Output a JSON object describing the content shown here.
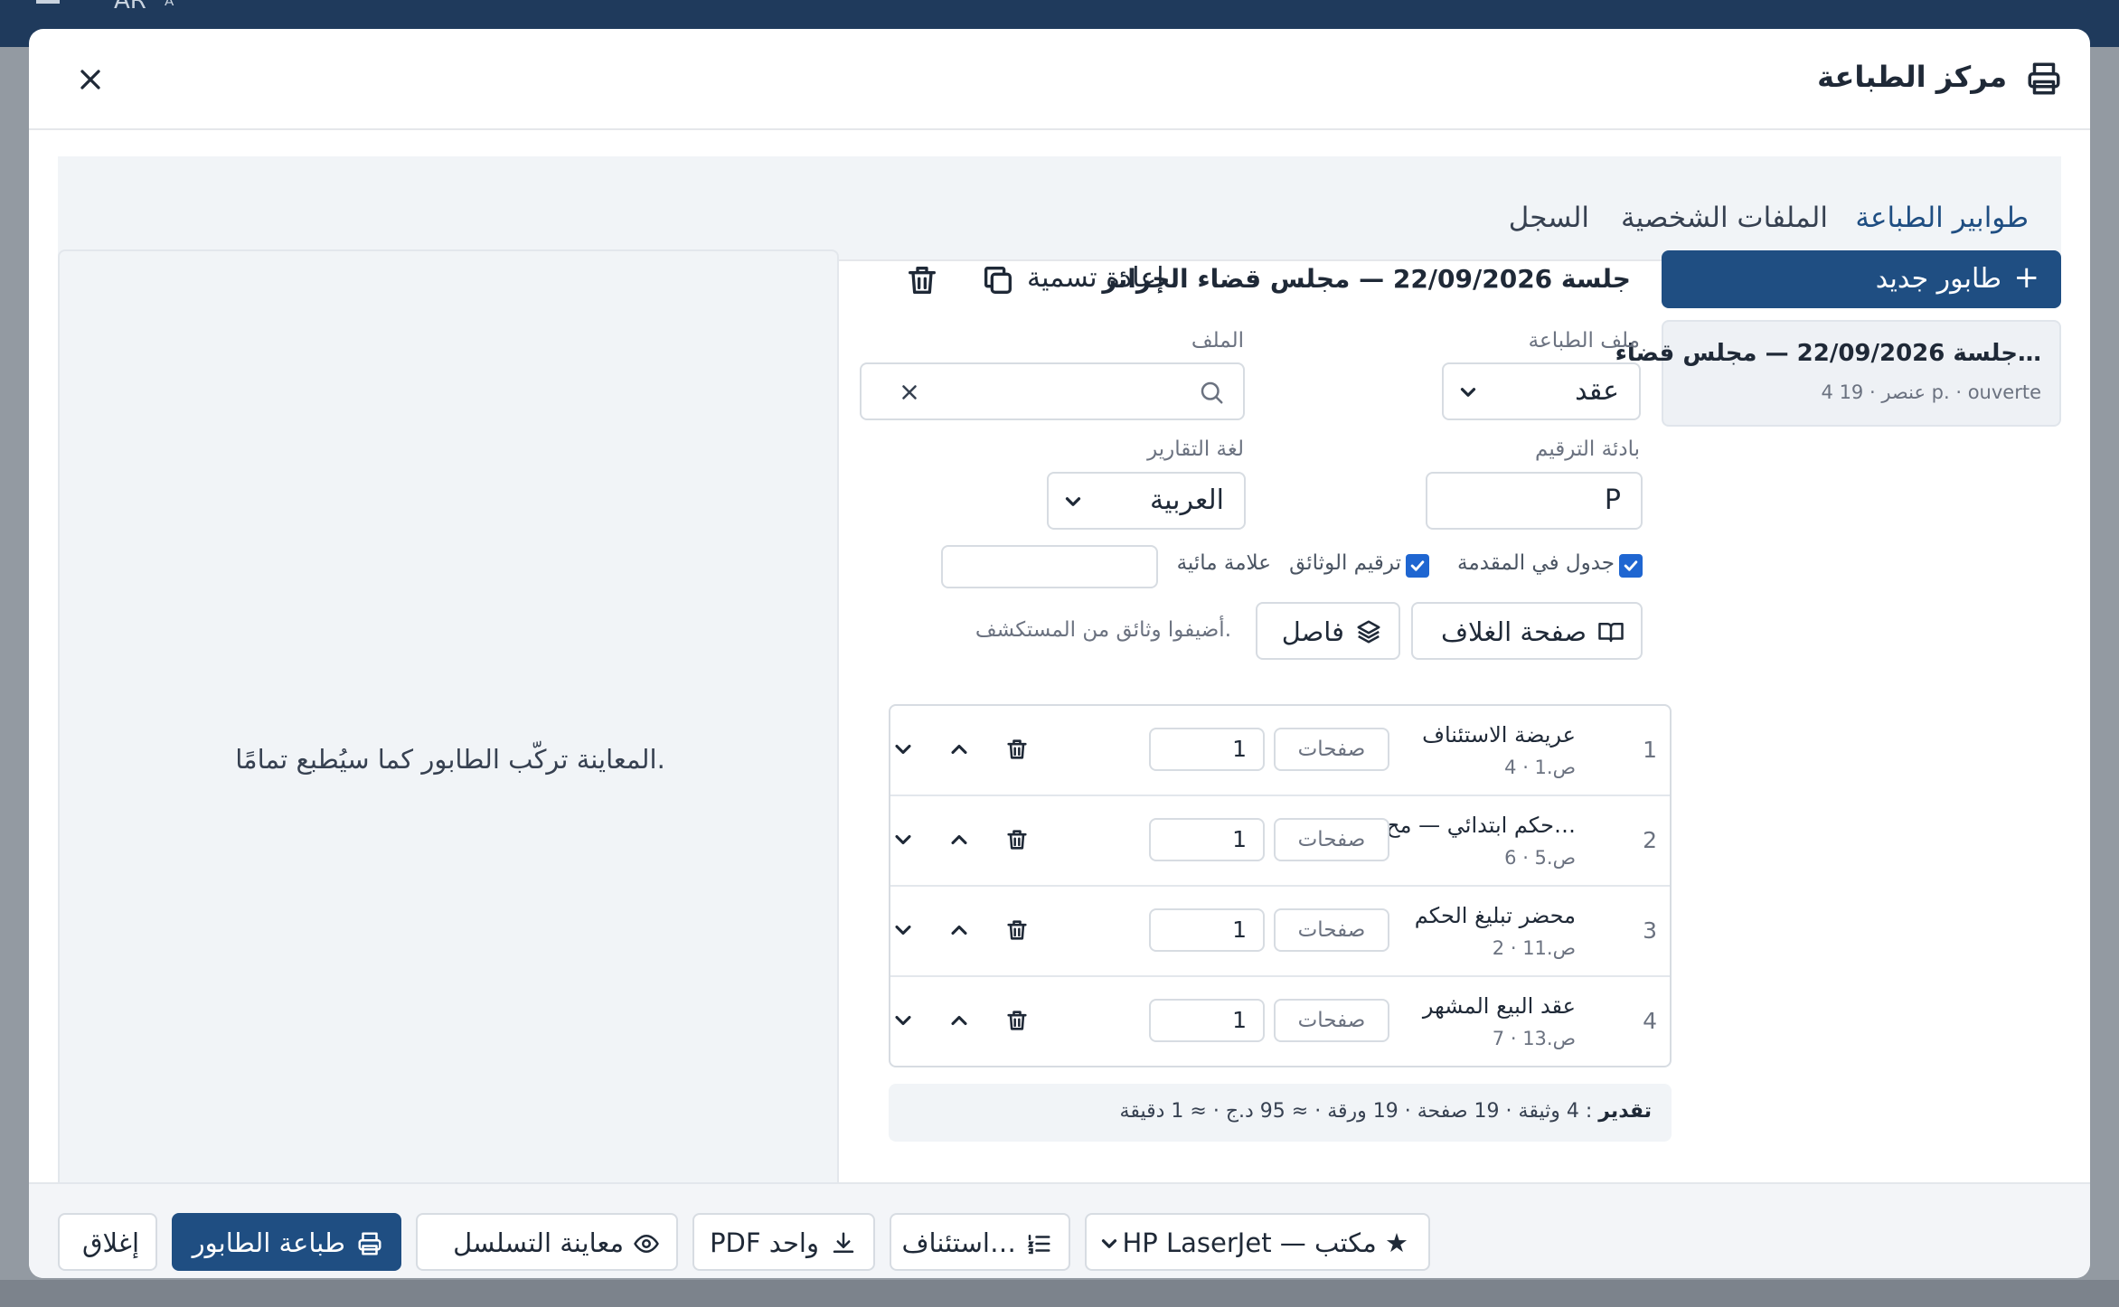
{
  "background": {
    "language_code": "AR"
  },
  "modal": {
    "title": "مركز الطباعة",
    "tabs": [
      {
        "label": "طوابير الطباعة",
        "active": true
      },
      {
        "label": "الملفات الشخصية",
        "active": false
      },
      {
        "label": "السجل",
        "active": false
      }
    ]
  },
  "sidebar": {
    "new_queue_label": "طابور جديد",
    "queues": [
      {
        "name": "جلسة 22/09/2026 — مجلس قضاء…",
        "meta": "4 عنصر · 19 p. · ouverte"
      }
    ]
  },
  "editor": {
    "queue_title": "جلسة 22/09/2026 — مجلس قضاء الجزائر",
    "rename_label": "إعادة تسمية",
    "profile": {
      "label": "ملف الطباعة",
      "value": "عقد"
    },
    "file": {
      "label": "الملف",
      "placeholder": ""
    },
    "numbering_prefix": {
      "label": "بادئة الترقيم",
      "value": "P"
    },
    "report_language": {
      "label": "لغة التقارير",
      "value": "العربية"
    },
    "toc_checkbox": {
      "label": "جدول في المقدمة",
      "checked": true
    },
    "numbering_checkbox": {
      "label": "ترقيم الوثائق",
      "checked": true
    },
    "watermark": {
      "label": "علامة مائية",
      "value": ""
    },
    "cover_page_label": "صفحة الغلاف",
    "separator_label": "فاصل",
    "add_hint": "أضيفوا وثائق من المستكشف.",
    "documents": [
      {
        "index": "1",
        "name": "عريضة الاستئناف",
        "pages": "ص.1 · 4",
        "pages_button": "صفحات",
        "copies": "1"
      },
      {
        "index": "2",
        "name": "حكم ابتدائي — مح…",
        "pages": "ص.5 · 6",
        "pages_button": "صفحات",
        "copies": "1"
      },
      {
        "index": "3",
        "name": "محضر تبليغ الحكم",
        "pages": "ص.11 · 2",
        "pages_button": "صفحات",
        "copies": "1"
      },
      {
        "index": "4",
        "name": "عقد البيع المشهر",
        "pages": "ص.13 · 7",
        "pages_button": "صفحات",
        "copies": "1"
      }
    ],
    "estimate": {
      "key": "تقدير",
      "text": ": 4 وثيقة · 19 صفحة · 19 ورقة · ≈ 95 د.ج · ≈ 1 دقيقة"
    }
  },
  "preview": {
    "text": "المعاينة تركّب الطابور كما سيُطبع تمامًا."
  },
  "footer": {
    "close_label": "إغلاق",
    "print_label": "طباعة الطابور",
    "preview_sequence_label": "معاينة التسلسل",
    "single_pdf_label": "PDF واحد",
    "resume_label": "استئناف…",
    "printer_label": "HP LaserJet — مكتب ★"
  },
  "colors": {
    "primary": "#1f4e82",
    "checkbox": "#1f66d1",
    "topbar": "#1f3a5c"
  }
}
